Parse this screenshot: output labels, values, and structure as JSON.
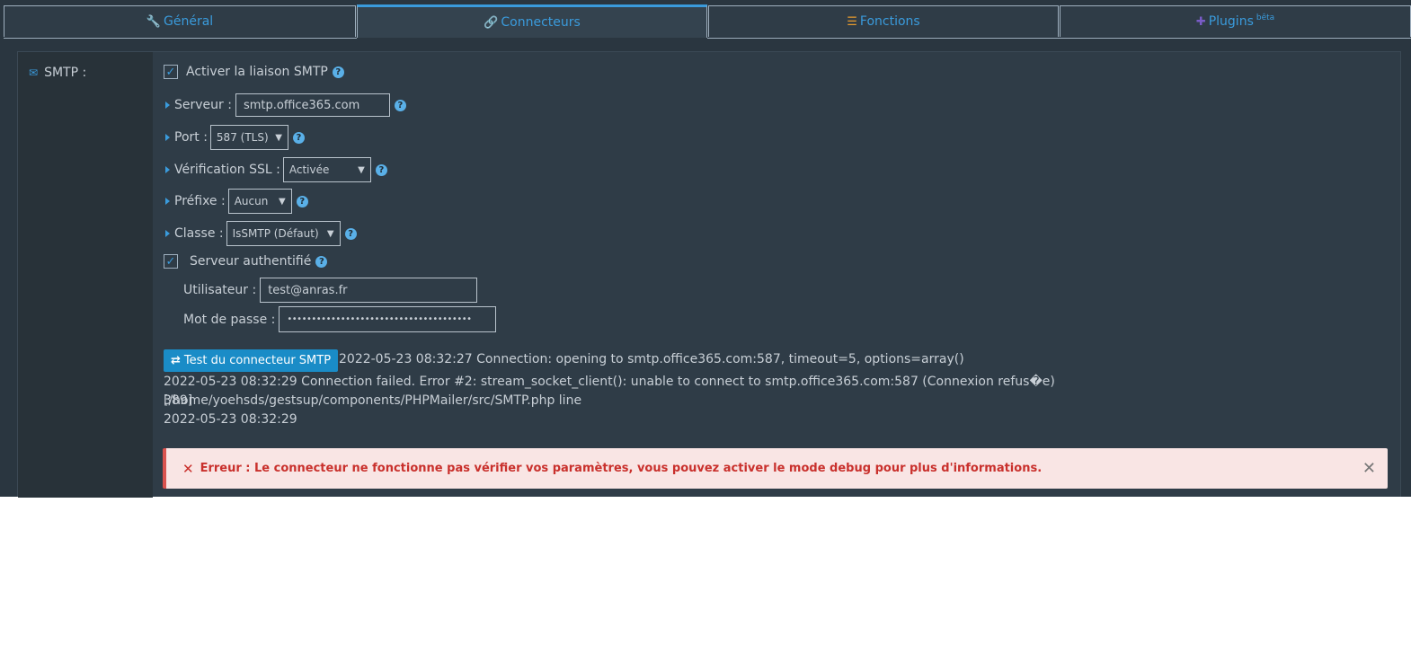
{
  "tabs": [
    {
      "label": "Général",
      "icon": "wrench-icon",
      "color": "#5aa33a"
    },
    {
      "label": "Connecteurs",
      "icon": "link-icon",
      "color": "#3a9bdc"
    },
    {
      "label": "Fonctions",
      "icon": "list-check-icon",
      "color": "#e69a2e"
    },
    {
      "label": "Plugins",
      "sup": "bêta",
      "icon": "puzzle-icon",
      "color": "#7a5cc7"
    }
  ],
  "section": {
    "label": "SMTP :",
    "icon": "envelope-icon"
  },
  "form": {
    "enable_label": "Activer la liaison SMTP",
    "server_label": "Serveur :",
    "server_value": "smtp.office365.com",
    "port_label": "Port :",
    "port_value": "587 (TLS)",
    "ssl_label": "Vérification SSL :",
    "ssl_value": "Activée",
    "prefix_label": "Préfixe :",
    "prefix_value": "Aucun",
    "class_label": "Classe :",
    "class_value": "IsSMTP (Défaut)",
    "auth_label": "Serveur authentifié",
    "user_label": "Utilisateur :",
    "user_value": "test@anras.fr",
    "password_label": "Mot de passe :",
    "password_value": "••••••••••••••••••••••••••••••••••••••"
  },
  "test": {
    "button_label": "Test du connecteur SMTP",
    "log_line1": "2022-05-23 08:32:27 Connection: opening to smtp.office365.com:587, timeout=5, options=array()",
    "log_line2": "2022-05-23 08:32:29 Connection failed. Error #2: stream_socket_client(): unable to connect to smtp.office365.com:587 (Connexion refus�e) [/home/yoehsds/gestsup/components/PHPMailer/src/SMTP.php line",
    "log_line3": "389]",
    "log_line4": "2022-05-23 08:32:29"
  },
  "alert": {
    "message": "Erreur : Le connecteur ne fonctionne pas vérifier vos paramètres, vous pouvez activer le mode debug pour plus d'informations."
  }
}
